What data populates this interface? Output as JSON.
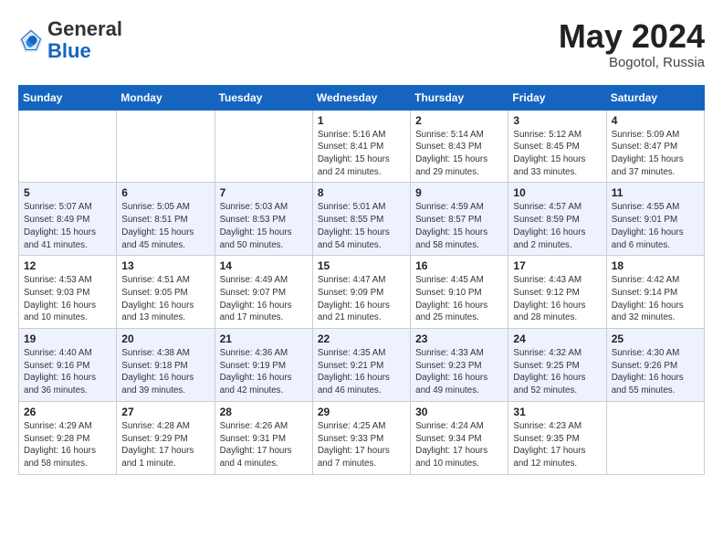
{
  "header": {
    "logo": {
      "general": "General",
      "blue": "Blue"
    },
    "month": "May 2024",
    "location": "Bogotol, Russia"
  },
  "days_of_week": [
    "Sunday",
    "Monday",
    "Tuesday",
    "Wednesday",
    "Thursday",
    "Friday",
    "Saturday"
  ],
  "weeks": [
    [
      {
        "day": "",
        "info": ""
      },
      {
        "day": "",
        "info": ""
      },
      {
        "day": "",
        "info": ""
      },
      {
        "day": "1",
        "info": "Sunrise: 5:16 AM\nSunset: 8:41 PM\nDaylight: 15 hours\nand 24 minutes."
      },
      {
        "day": "2",
        "info": "Sunrise: 5:14 AM\nSunset: 8:43 PM\nDaylight: 15 hours\nand 29 minutes."
      },
      {
        "day": "3",
        "info": "Sunrise: 5:12 AM\nSunset: 8:45 PM\nDaylight: 15 hours\nand 33 minutes."
      },
      {
        "day": "4",
        "info": "Sunrise: 5:09 AM\nSunset: 8:47 PM\nDaylight: 15 hours\nand 37 minutes."
      }
    ],
    [
      {
        "day": "5",
        "info": "Sunrise: 5:07 AM\nSunset: 8:49 PM\nDaylight: 15 hours\nand 41 minutes."
      },
      {
        "day": "6",
        "info": "Sunrise: 5:05 AM\nSunset: 8:51 PM\nDaylight: 15 hours\nand 45 minutes."
      },
      {
        "day": "7",
        "info": "Sunrise: 5:03 AM\nSunset: 8:53 PM\nDaylight: 15 hours\nand 50 minutes."
      },
      {
        "day": "8",
        "info": "Sunrise: 5:01 AM\nSunset: 8:55 PM\nDaylight: 15 hours\nand 54 minutes."
      },
      {
        "day": "9",
        "info": "Sunrise: 4:59 AM\nSunset: 8:57 PM\nDaylight: 15 hours\nand 58 minutes."
      },
      {
        "day": "10",
        "info": "Sunrise: 4:57 AM\nSunset: 8:59 PM\nDaylight: 16 hours\nand 2 minutes."
      },
      {
        "day": "11",
        "info": "Sunrise: 4:55 AM\nSunset: 9:01 PM\nDaylight: 16 hours\nand 6 minutes."
      }
    ],
    [
      {
        "day": "12",
        "info": "Sunrise: 4:53 AM\nSunset: 9:03 PM\nDaylight: 16 hours\nand 10 minutes."
      },
      {
        "day": "13",
        "info": "Sunrise: 4:51 AM\nSunset: 9:05 PM\nDaylight: 16 hours\nand 13 minutes."
      },
      {
        "day": "14",
        "info": "Sunrise: 4:49 AM\nSunset: 9:07 PM\nDaylight: 16 hours\nand 17 minutes."
      },
      {
        "day": "15",
        "info": "Sunrise: 4:47 AM\nSunset: 9:09 PM\nDaylight: 16 hours\nand 21 minutes."
      },
      {
        "day": "16",
        "info": "Sunrise: 4:45 AM\nSunset: 9:10 PM\nDaylight: 16 hours\nand 25 minutes."
      },
      {
        "day": "17",
        "info": "Sunrise: 4:43 AM\nSunset: 9:12 PM\nDaylight: 16 hours\nand 28 minutes."
      },
      {
        "day": "18",
        "info": "Sunrise: 4:42 AM\nSunset: 9:14 PM\nDaylight: 16 hours\nand 32 minutes."
      }
    ],
    [
      {
        "day": "19",
        "info": "Sunrise: 4:40 AM\nSunset: 9:16 PM\nDaylight: 16 hours\nand 36 minutes."
      },
      {
        "day": "20",
        "info": "Sunrise: 4:38 AM\nSunset: 9:18 PM\nDaylight: 16 hours\nand 39 minutes."
      },
      {
        "day": "21",
        "info": "Sunrise: 4:36 AM\nSunset: 9:19 PM\nDaylight: 16 hours\nand 42 minutes."
      },
      {
        "day": "22",
        "info": "Sunrise: 4:35 AM\nSunset: 9:21 PM\nDaylight: 16 hours\nand 46 minutes."
      },
      {
        "day": "23",
        "info": "Sunrise: 4:33 AM\nSunset: 9:23 PM\nDaylight: 16 hours\nand 49 minutes."
      },
      {
        "day": "24",
        "info": "Sunrise: 4:32 AM\nSunset: 9:25 PM\nDaylight: 16 hours\nand 52 minutes."
      },
      {
        "day": "25",
        "info": "Sunrise: 4:30 AM\nSunset: 9:26 PM\nDaylight: 16 hours\nand 55 minutes."
      }
    ],
    [
      {
        "day": "26",
        "info": "Sunrise: 4:29 AM\nSunset: 9:28 PM\nDaylight: 16 hours\nand 58 minutes."
      },
      {
        "day": "27",
        "info": "Sunrise: 4:28 AM\nSunset: 9:29 PM\nDaylight: 17 hours\nand 1 minute."
      },
      {
        "day": "28",
        "info": "Sunrise: 4:26 AM\nSunset: 9:31 PM\nDaylight: 17 hours\nand 4 minutes."
      },
      {
        "day": "29",
        "info": "Sunrise: 4:25 AM\nSunset: 9:33 PM\nDaylight: 17 hours\nand 7 minutes."
      },
      {
        "day": "30",
        "info": "Sunrise: 4:24 AM\nSunset: 9:34 PM\nDaylight: 17 hours\nand 10 minutes."
      },
      {
        "day": "31",
        "info": "Sunrise: 4:23 AM\nSunset: 9:35 PM\nDaylight: 17 hours\nand 12 minutes."
      },
      {
        "day": "",
        "info": ""
      }
    ]
  ]
}
